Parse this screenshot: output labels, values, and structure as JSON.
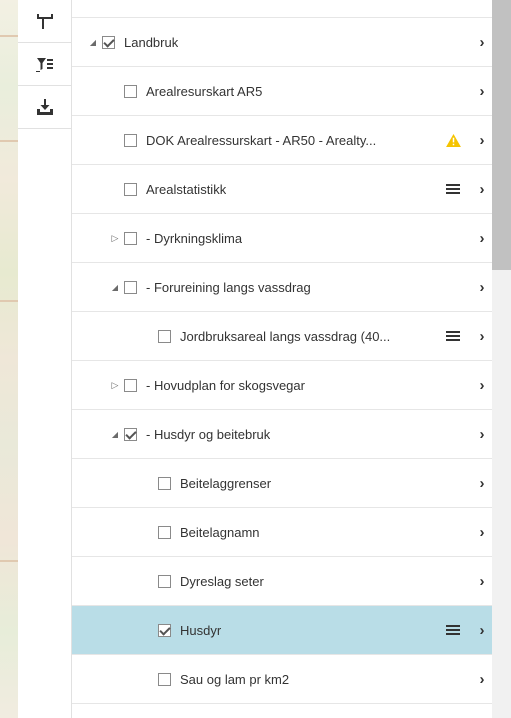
{
  "toolbar": {
    "buttons": [
      {
        "name": "measure-tool-icon"
      },
      {
        "name": "filter-list-icon"
      },
      {
        "name": "download-icon"
      }
    ]
  },
  "layers": [
    {
      "label": "Landbruk",
      "checked": true,
      "expander": "open",
      "level": 0
    },
    {
      "label": "Arealresurskart AR5",
      "checked": false,
      "expander": "none",
      "level": 1
    },
    {
      "label": "DOK Arealressurskart - AR50 - Arealty...",
      "checked": false,
      "expander": "none",
      "level": 1,
      "warning": true
    },
    {
      "label": "Arealstatistikk",
      "checked": false,
      "expander": "none",
      "level": 1,
      "menu": true
    },
    {
      "label": "- Dyrkningsklima",
      "checked": false,
      "expander": "closed",
      "level": 1
    },
    {
      "label": "- Forureining langs vassdrag",
      "checked": false,
      "expander": "open",
      "level": 1
    },
    {
      "label": "Jordbruksareal langs vassdrag (40...",
      "checked": false,
      "expander": "none",
      "level": 2,
      "menu": true
    },
    {
      "label": "- Hovudplan for skogsvegar",
      "checked": false,
      "expander": "closed",
      "level": 1
    },
    {
      "label": "- Husdyr og beitebruk",
      "checked": true,
      "expander": "open",
      "level": 1
    },
    {
      "label": "Beitelaggrenser",
      "checked": false,
      "expander": "none",
      "level": 2
    },
    {
      "label": "Beitelagnamn",
      "checked": false,
      "expander": "none",
      "level": 2
    },
    {
      "label": "Dyreslag seter",
      "checked": false,
      "expander": "none",
      "level": 2
    },
    {
      "label": "Husdyr",
      "checked": true,
      "expander": "none",
      "level": 2,
      "menu": true,
      "selected": true
    },
    {
      "label": "Sau og lam pr km2",
      "checked": false,
      "expander": "none",
      "level": 2
    }
  ],
  "colors": {
    "selected_row": "#b9dde7",
    "warning": "#f5c400"
  }
}
